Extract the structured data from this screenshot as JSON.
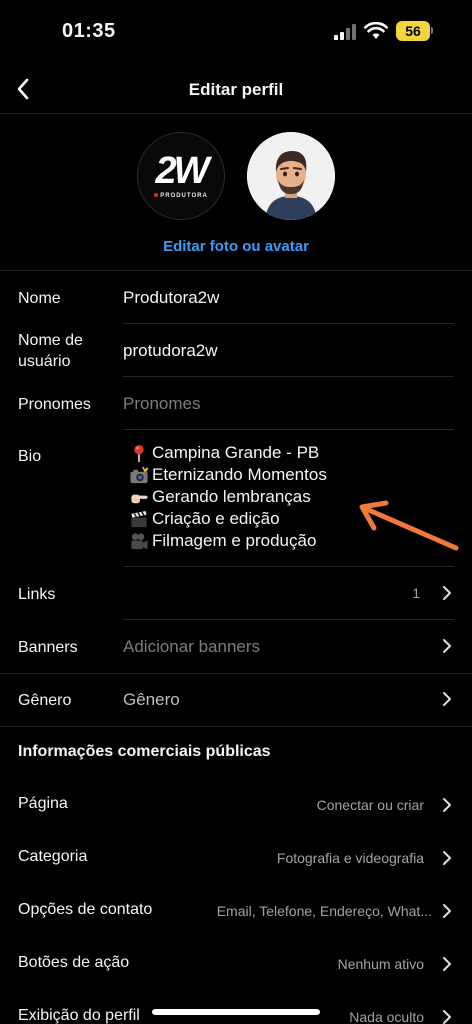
{
  "status_bar": {
    "time": "01:35",
    "battery": "56"
  },
  "header": {
    "title": "Editar perfil"
  },
  "avatars": {
    "logo_text": "2W",
    "logo_subtext": "PRODUTORA",
    "edit_label": "Editar foto ou avatar"
  },
  "fields": {
    "name": {
      "label": "Nome",
      "value": "Produtora2w"
    },
    "username": {
      "label_line1": "Nome de",
      "label_line2": "usuário",
      "value": "protudora2w"
    },
    "pronouns": {
      "label": "Pronomes",
      "placeholder": "Pronomes"
    },
    "bio": {
      "label": "Bio",
      "lines": [
        {
          "icon": "pin-icon",
          "text": "Campina Grande - PB"
        },
        {
          "icon": "camera-flash-icon",
          "text": "Eternizando Momentos"
        },
        {
          "icon": "pointing-hand-icon",
          "text": "Gerando lembranças"
        },
        {
          "icon": "clapperboard-icon",
          "text": "Criação e edição"
        },
        {
          "icon": "movie-camera-icon",
          "text": "Filmagem e produção"
        }
      ]
    },
    "links": {
      "label": "Links",
      "count": "1"
    },
    "banners": {
      "label": "Banners",
      "placeholder": "Adicionar banners"
    },
    "gender": {
      "label": "Gênero",
      "placeholder": "Gênero"
    }
  },
  "business": {
    "title": "Informações comerciais públicas",
    "rows": [
      {
        "label": "Página",
        "value": "Conectar ou criar"
      },
      {
        "label": "Categoria",
        "value": "Fotografia e videografia"
      },
      {
        "label": "Opções de contato",
        "value": "Email, Telefone, Endereço, What..."
      },
      {
        "label": "Botões de ação",
        "value": "Nenhum ativo"
      },
      {
        "label": "Exibição do perfil",
        "value": "Nada oculto"
      }
    ]
  },
  "colors": {
    "accent": "#3b9bf5",
    "annotation_arrow": "#f07a3a",
    "battery": "#f2d43c"
  }
}
